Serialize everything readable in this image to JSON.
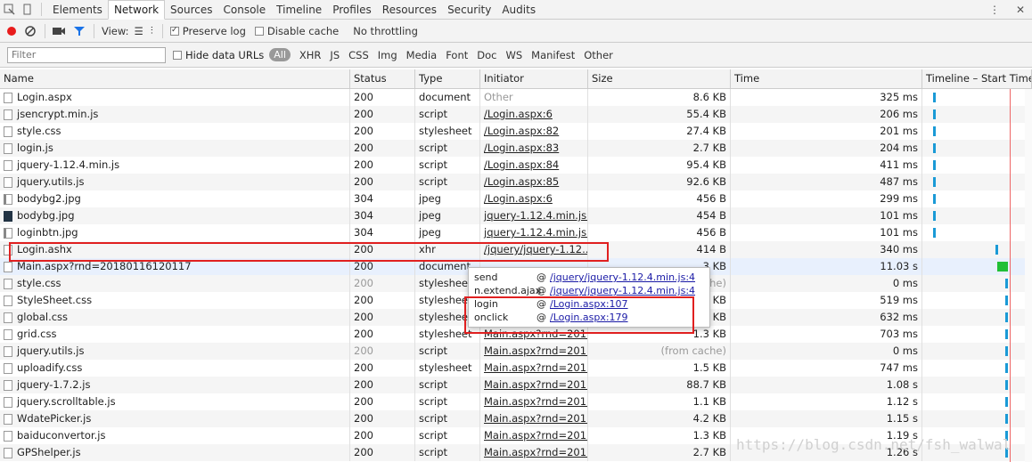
{
  "tabs": [
    "Elements",
    "Network",
    "Sources",
    "Console",
    "Timeline",
    "Profiles",
    "Resources",
    "Security",
    "Audits"
  ],
  "toolbar": {
    "view_label": "View:",
    "preserve_log": "Preserve log",
    "disable_cache": "Disable cache",
    "throttling": "No throttling"
  },
  "filter": {
    "placeholder": "Filter",
    "hide_data_urls": "Hide data URLs",
    "types": [
      "All",
      "XHR",
      "JS",
      "CSS",
      "Img",
      "Media",
      "Font",
      "Doc",
      "WS",
      "Manifest",
      "Other"
    ]
  },
  "columns": {
    "name": "Name",
    "status": "Status",
    "type": "Type",
    "initiator": "Initiator",
    "size": "Size",
    "time": "Time",
    "timeline": "Timeline – Start Time"
  },
  "rows": [
    {
      "name": "Login.aspx",
      "status": "200",
      "type": "document",
      "initiator": "Other",
      "size": "8.6 KB",
      "time": "325 ms"
    },
    {
      "name": "jsencrypt.min.js",
      "status": "200",
      "type": "script",
      "initiator": "/Login.aspx:6",
      "size": "55.4 KB",
      "time": "206 ms"
    },
    {
      "name": "style.css",
      "status": "200",
      "type": "stylesheet",
      "initiator": "/Login.aspx:82",
      "size": "27.4 KB",
      "time": "201 ms"
    },
    {
      "name": "login.js",
      "status": "200",
      "type": "script",
      "initiator": "/Login.aspx:83",
      "size": "2.7 KB",
      "time": "204 ms"
    },
    {
      "name": "jquery-1.12.4.min.js",
      "status": "200",
      "type": "script",
      "initiator": "/Login.aspx:84",
      "size": "95.4 KB",
      "time": "411 ms"
    },
    {
      "name": "jquery.utils.js",
      "status": "200",
      "type": "script",
      "initiator": "/Login.aspx:85",
      "size": "92.6 KB",
      "time": "487 ms"
    },
    {
      "name": "bodybg2.jpg",
      "status": "304",
      "type": "jpeg",
      "initiator": "/Login.aspx:6",
      "size": "456 B",
      "time": "299 ms"
    },
    {
      "name": "bodybg.jpg",
      "status": "304",
      "type": "jpeg",
      "initiator": "jquery-1.12.4.min.js:2",
      "size": "454 B",
      "time": "101 ms"
    },
    {
      "name": "loginbtn.jpg",
      "status": "304",
      "type": "jpeg",
      "initiator": "jquery-1.12.4.min.js:2",
      "size": "456 B",
      "time": "101 ms"
    },
    {
      "name": "Login.ashx",
      "status": "200",
      "type": "xhr",
      "initiator": "/jquery/jquery-1.12...",
      "size": "414 B",
      "time": "340 ms"
    },
    {
      "name": "Main.aspx?rnd=20180116120117",
      "status": "200",
      "type": "document",
      "initiator": "",
      "size": "3 KB",
      "time": "11.03 s"
    },
    {
      "name": "style.css",
      "status": "200",
      "type": "stylesheet",
      "initiator": "",
      "size": "che)",
      "time": "0 ms"
    },
    {
      "name": "StyleSheet.css",
      "status": "200",
      "type": "stylesheet",
      "initiator": "",
      "size": "8 KB",
      "time": "519 ms"
    },
    {
      "name": "global.css",
      "status": "200",
      "type": "stylesheet",
      "initiator": "",
      "size": "7 KB",
      "time": "632 ms"
    },
    {
      "name": "grid.css",
      "status": "200",
      "type": "stylesheet",
      "initiator": "Main.aspx?rnd=201...",
      "size": "1.3 KB",
      "time": "703 ms"
    },
    {
      "name": "jquery.utils.js",
      "status": "200",
      "type": "script",
      "initiator": "Main.aspx?rnd=201...",
      "size": "(from cache)",
      "time": "0 ms"
    },
    {
      "name": "uploadify.css",
      "status": "200",
      "type": "stylesheet",
      "initiator": "Main.aspx?rnd=201...",
      "size": "1.5 KB",
      "time": "747 ms"
    },
    {
      "name": "jquery-1.7.2.js",
      "status": "200",
      "type": "script",
      "initiator": "Main.aspx?rnd=201...",
      "size": "88.7 KB",
      "time": "1.08 s"
    },
    {
      "name": "jquery.scrolltable.js",
      "status": "200",
      "type": "script",
      "initiator": "Main.aspx?rnd=201...",
      "size": "1.1 KB",
      "time": "1.12 s"
    },
    {
      "name": "WdatePicker.js",
      "status": "200",
      "type": "script",
      "initiator": "Main.aspx?rnd=201...",
      "size": "4.2 KB",
      "time": "1.15 s"
    },
    {
      "name": "baiduconvertor.js",
      "status": "200",
      "type": "script",
      "initiator": "Main.aspx?rnd=201...",
      "size": "1.3 KB",
      "time": "1.19 s"
    },
    {
      "name": "GPShelper.js",
      "status": "200",
      "type": "script",
      "initiator": "Main.aspx?rnd=201...",
      "size": "2.7 KB",
      "time": "1.26 s"
    }
  ],
  "popup": [
    {
      "fn": "send",
      "at": "@",
      "loc": "/jquery/jquery-1.12.4.min.js:4"
    },
    {
      "fn": "n.extend.ajax",
      "at": "@",
      "loc": "/jquery/jquery-1.12.4.min.js:4"
    },
    {
      "fn": "login",
      "at": "@",
      "loc": "/Login.aspx:107"
    },
    {
      "fn": "onclick",
      "at": "@",
      "loc": "/Login.aspx:179"
    }
  ],
  "watermark": "https://blog.csdn.net/fsh_walwal"
}
